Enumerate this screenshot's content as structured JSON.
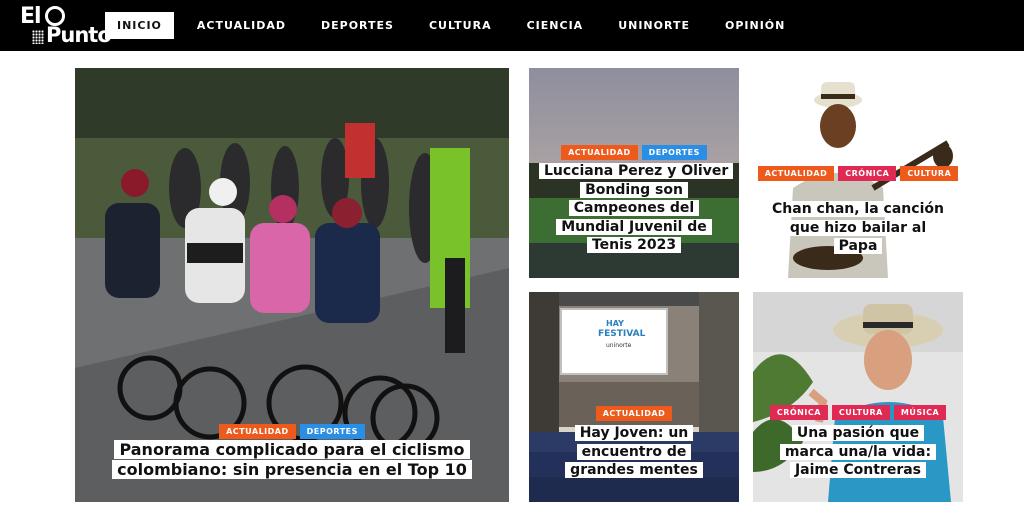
{
  "logo": {
    "line1": "El",
    "line2": "Punto",
    "aria": "El Punto"
  },
  "nav": {
    "items": [
      {
        "label": "INICIO"
      },
      {
        "label": "ACTUALIDAD"
      },
      {
        "label": "DEPORTES"
      },
      {
        "label": "CULTURA"
      },
      {
        "label": "CIENCIA"
      },
      {
        "label": "UNINORTE"
      },
      {
        "label": "OPINIÓN"
      }
    ]
  },
  "colors": {
    "actualidad": "#ee5a1b",
    "deportes": "#2a8ee4",
    "cronica_cultura_musica": "#e02a53"
  },
  "articles": {
    "main": {
      "tags": [
        "ACTUALIDAD",
        "DEPORTES"
      ],
      "title": "Panorama complicado para el ciclismo colombiano: sin presencia en el Top 10"
    },
    "tennis": {
      "tags": [
        "ACTUALIDAD",
        "DEPORTES"
      ],
      "title": "Lucciana Perez y Oliver Bonding son Campeones del Mundial Juvenil de Tenis 2023"
    },
    "chanchan": {
      "tags": [
        "ACTUALIDAD",
        "CRÓNICA",
        "CULTURA"
      ],
      "title": "Chan chan, la canción que hizo bailar al Papa"
    },
    "hay": {
      "tags": [
        "ACTUALIDAD"
      ],
      "title": "Hay Joven: un encuentro de grandes mentes",
      "screen_line1": "HAY",
      "screen_line2": "FESTIVAL",
      "screen_line3": "uninorte"
    },
    "jaime": {
      "tags": [
        "CRÓNICA",
        "CULTURA",
        "MÚSICA"
      ],
      "title": "Una pasión que marca una/la vida: Jaime Contreras"
    }
  }
}
